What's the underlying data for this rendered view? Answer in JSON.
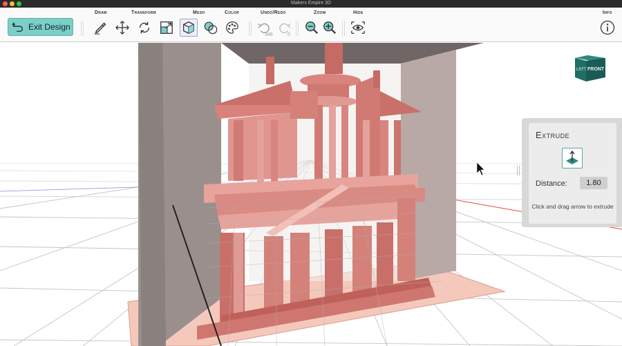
{
  "window": {
    "title": "Makers Empire 3D"
  },
  "toolbar": {
    "exit_label": "Exit Design",
    "groups": {
      "draw": "Draw",
      "transform": "Transform",
      "mesh": "Mesh",
      "color": "Color",
      "undo_redo": "Undo/Redo",
      "zoom": "Zoom",
      "hide": "Hide",
      "info": "Info"
    },
    "undo_count": "346",
    "redo_count": "0",
    "accent_color": "#7ccfc7"
  },
  "view_cube": {
    "left_face": "LEFT",
    "front_face": "FRONT",
    "color": "#1f6f66"
  },
  "extrude_panel": {
    "title": "Extrude",
    "distance_label": "Distance:",
    "distance_value": "1.80",
    "hint": "Click and drag arrow to extrude"
  },
  "scene": {
    "model_color": "#e2918a",
    "grid_color": "#b8b8b8"
  }
}
